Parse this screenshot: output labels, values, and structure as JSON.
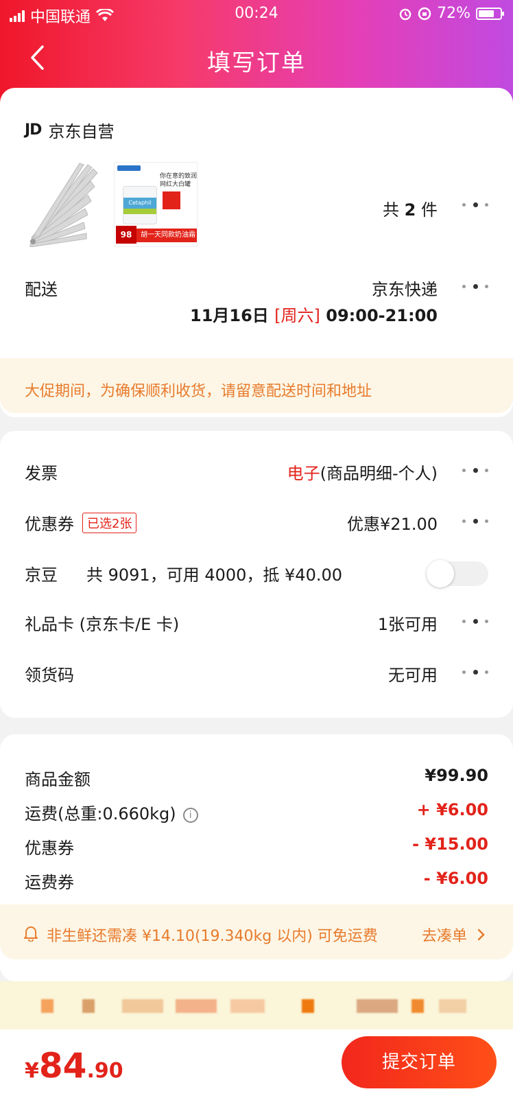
{
  "status_bar": {
    "carrier": "中国联通",
    "time": "00:24",
    "battery": "72%"
  },
  "header": {
    "title": "填写订单"
  },
  "shop": {
    "logo": "JD",
    "name": "京东自营"
  },
  "products": {
    "count_prefix": "共",
    "count": "2",
    "count_suffix": "件",
    "cetaphil": {
      "brand": "Cetaphil",
      "tagline1": "你在意的致润",
      "tagline2": "网红大白罐",
      "badge": "98",
      "banner": "胡一天同款奶油霜"
    }
  },
  "delivery": {
    "label": "配送",
    "method": "京东快递",
    "date": "11月16日",
    "weekday": "[周六]",
    "window": "09:00-21:00"
  },
  "promo_notice": "大促期间，为确保顺利收货，请留意配送时间和地址",
  "invoice": {
    "label": "发票",
    "type": "电子",
    "detail": "(商品明细-个人)"
  },
  "coupon": {
    "label": "优惠券",
    "tag": "已选2张",
    "value": "优惠¥21.00"
  },
  "jingdou": {
    "label": "京豆",
    "detail": "共 9091，可用 4000，抵 ¥40.00",
    "enabled": false
  },
  "giftcard": {
    "label": "礼品卡 (京东卡/E 卡)",
    "value": "1张可用"
  },
  "pickup_code": {
    "label": "领货码",
    "value": "无可用"
  },
  "summary": {
    "goods": {
      "label": "商品金额",
      "value": "¥99.90"
    },
    "shipping": {
      "label": "运费(总重:0.660kg)",
      "value": "+ ¥6.00"
    },
    "coupon": {
      "label": "优惠券",
      "value": "- ¥15.00"
    },
    "shipping_coupon": {
      "label": "运费券",
      "value": "- ¥6.00"
    }
  },
  "freeship_notice": {
    "text": "非生鲜还需凑 ¥14.10(19.340kg 以内) 可免运费",
    "action": "去凑单"
  },
  "footer": {
    "currency": "¥",
    "price_int": "84",
    "price_dec": ".90",
    "submit_label": "提交订单"
  },
  "colors": {
    "accent_red": "#e2231a",
    "notice_orange": "#e77b2d",
    "notice_bg": "#fdf6e6"
  },
  "icons": [
    "signal-icon",
    "wifi-icon",
    "alarm-icon",
    "rotation-lock-icon",
    "battery-icon",
    "back-arrow-icon",
    "more-dots-icon",
    "info-icon",
    "bell-icon",
    "chevron-right-icon"
  ]
}
